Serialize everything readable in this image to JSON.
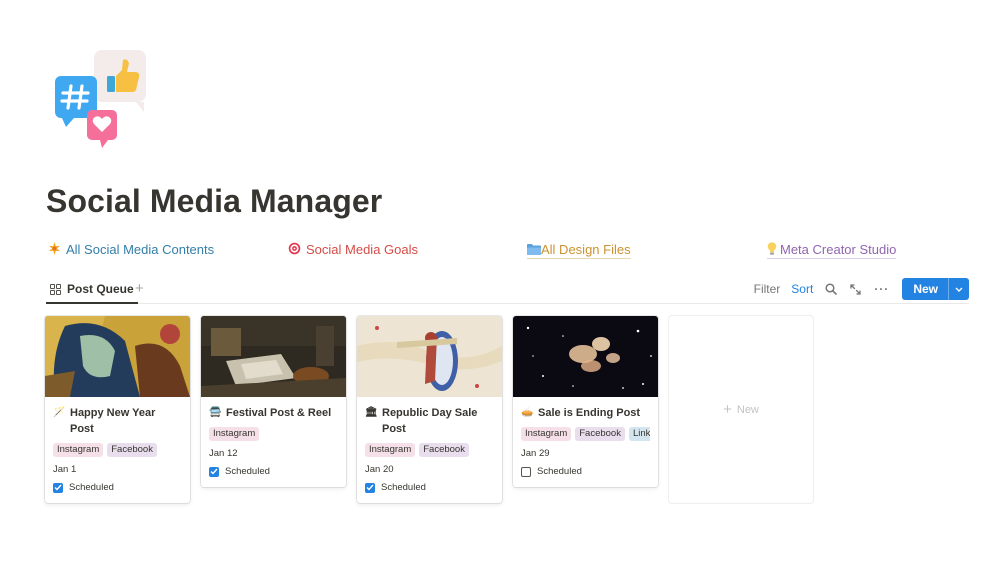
{
  "page": {
    "title": "Social Media Manager"
  },
  "links": [
    {
      "label": "All Social Media Contents",
      "icon": "sparkle-icon",
      "color": "#337ea9"
    },
    {
      "label": "Social Media Goals",
      "icon": "target-icon",
      "color": "#d44c47"
    },
    {
      "label": "All Design Files",
      "icon": "folder-icon",
      "color": "#cb912f"
    },
    {
      "label": "Meta Creator Studio",
      "icon": "lightbulb-icon",
      "color": "#9065b0"
    }
  ],
  "toolbar": {
    "view_tab": "Post Queue",
    "filter": "Filter",
    "sort": "Sort",
    "new": "New"
  },
  "cards": [
    {
      "title": "Happy New Year Post",
      "emoji": "🪄",
      "tags": [
        "Instagram",
        "Facebook"
      ],
      "date": "Jan 1",
      "status": "Scheduled",
      "checked": true
    },
    {
      "title": "Festival Post & Reel",
      "emoji": "🚍",
      "tags": [
        "Instagram"
      ],
      "date": "Jan 12",
      "status": "Scheduled",
      "checked": true
    },
    {
      "title": "Republic Day Sale Post",
      "emoji": "🏛",
      "tags": [
        "Instagram",
        "Facebook"
      ],
      "date": "Jan 20",
      "status": "Scheduled",
      "checked": true
    },
    {
      "title": "Sale is Ending Post",
      "emoji": "🥧",
      "tags": [
        "Instagram",
        "Facebook",
        "Linked"
      ],
      "date": "Jan 29",
      "status": "Scheduled",
      "checked": false
    }
  ],
  "new_card": {
    "label": "New"
  },
  "colors": {
    "accent": "#2383e2",
    "text": "#37352f"
  }
}
